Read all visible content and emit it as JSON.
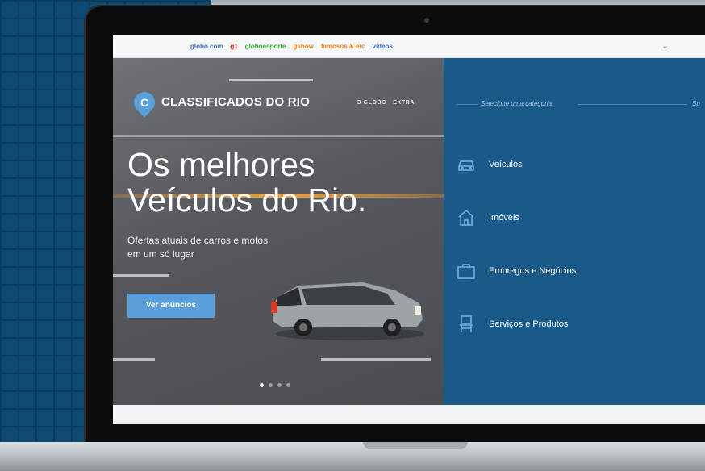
{
  "globo_bar": {
    "links": [
      {
        "label": "globo.com",
        "color": "#3b6fb6"
      },
      {
        "label": "g1",
        "color": "#c4170c"
      },
      {
        "label": "globoesporte",
        "color": "#39a935"
      },
      {
        "label": "gshow",
        "color": "#f27e1f"
      },
      {
        "label": "famosos & etc",
        "color": "#f27e1f"
      },
      {
        "label": "vídeos",
        "color": "#3b6fb6"
      }
    ],
    "chevron": "⌄"
  },
  "brand": {
    "logo_letter": "C",
    "name": "CLASSIFICADOS DO RIO",
    "partners": [
      "O GLOBO",
      "EXTRA"
    ],
    "accent": "#5a9fd9"
  },
  "hero": {
    "title_line1": "Os melhores",
    "title_line2": "Veículos do Rio.",
    "subtitle": "Ofertas atuais de carros e motos em um só lugar",
    "cta_label": "Ver anúncios",
    "slides_total": 4,
    "slide_active": 1
  },
  "categories": {
    "select_label": "Selecione uma categoria",
    "right_label": "Sp",
    "panel_color": "#1a5a8a",
    "items": [
      {
        "label": "Veículos",
        "icon": "car-icon"
      },
      {
        "label": "Imóveis",
        "icon": "house-icon"
      },
      {
        "label": "Empregos e Negócios",
        "icon": "briefcase-icon"
      },
      {
        "label": "Serviços e Produtos",
        "icon": "chair-icon"
      }
    ]
  }
}
